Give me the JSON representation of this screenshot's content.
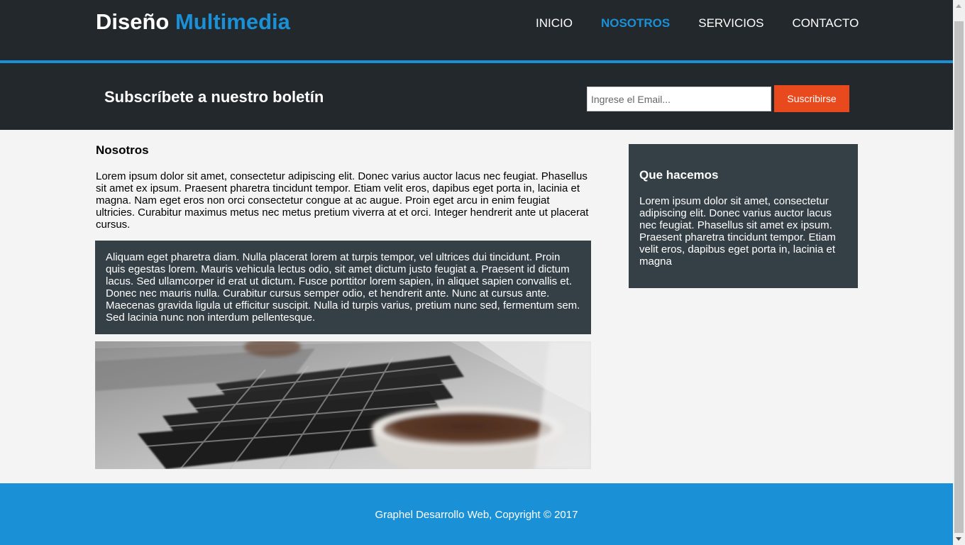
{
  "header": {
    "brand_main": "Diseño",
    "brand_highlight": "Multimedia",
    "nav": [
      {
        "label": "INICIO",
        "active": false
      },
      {
        "label": "NOSOTROS",
        "active": true
      },
      {
        "label": "SERVICIOS",
        "active": false
      },
      {
        "label": "CONTACTO",
        "active": false
      }
    ]
  },
  "newsletter": {
    "title": "Subscríbete a nuestro boletín",
    "email_placeholder": "Ingrese el Email...",
    "email_value": "",
    "button_label": "Suscribirse"
  },
  "main": {
    "title": "Nosotros",
    "paragraph": "Lorem ipsum dolor sit amet, consectetur adipiscing elit. Donec varius auctor lacus nec feugiat. Phasellus sit amet ex ipsum. Praesent pharetra tincidunt tempor. Etiam velit eros, dapibus eget porta in, lacinia et magna. Nam eget eros non orci consectetur congue at ac augue. Proin eget arcu in enim feugiat ultricies. Curabitur maximus metus nec metus pretium viverra at et orci. Integer hendrerit ante ut placerat cursus.",
    "dark_box": "Aliquam eget pharetra diam. Nulla placerat lorem at turpis tempor, vel ultrices dui tincidunt. Proin quis egestas lorem. Mauris vehicula lectus odio, sit amet dictum justo feugiat a. Praesent id dictum lacus. Sed ullamcorper id erat ut dictum. Fusce porttitor lorem sapien, in aliquet sapien convallis et. Donec nec mauris nulla. Curabitur cursus semper odio, et hendrerit ante. Nunc at cursus ante. Maecenas gravida ligula ut efficitur suscipit. Nulla id turpis varius, pretium nunc sed, fermentum sem. Sed lacinia nunc non interdum pellentesque."
  },
  "sidebar": {
    "title": "Que hacemos",
    "text": "Lorem ipsum dolor sit amet, consectetur adipiscing elit. Donec varius auctor lacus nec feugiat. Phasellus sit amet ex ipsum. Praesent pharetra tincidunt tempor. Etiam velit eros, dapibus eget porta in, lacinia et magna"
  },
  "footer": {
    "text": "Graphel Desarrollo Web, Copyright © 2017"
  },
  "colors": {
    "header_bg": "#23282d",
    "accent_blue": "#1a90d6",
    "button_orange": "#e8491d",
    "box_bg": "#353f46",
    "page_bg": "#f4f4f4"
  }
}
